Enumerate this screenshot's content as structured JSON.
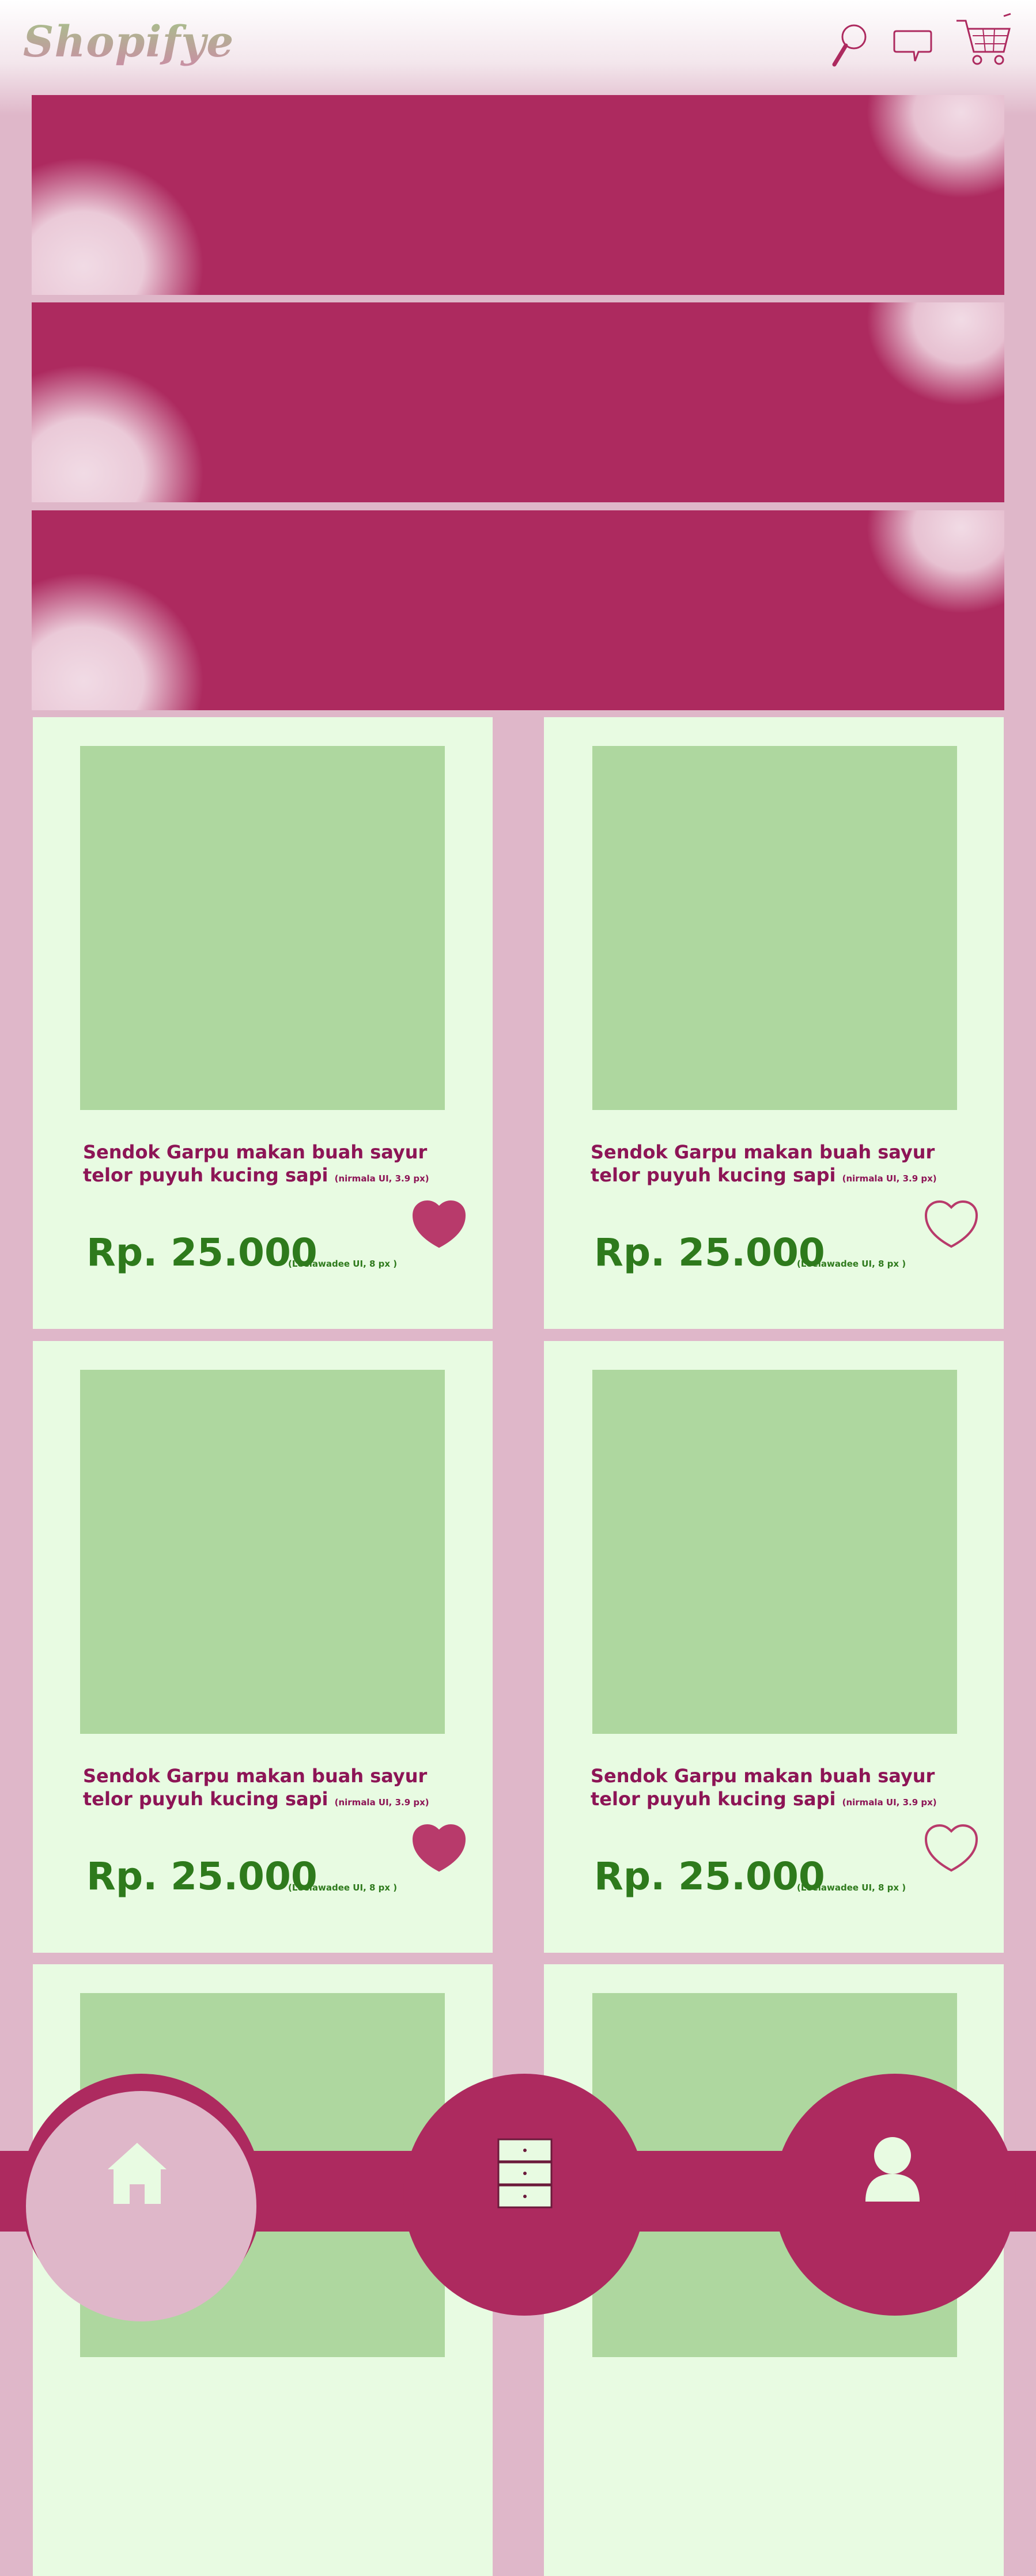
{
  "app": {
    "title": "Shopifye"
  },
  "header": {
    "icons": [
      "search-icon",
      "chat-icon",
      "cart-icon"
    ]
  },
  "colors": {
    "accent": "#ad2a5f",
    "background": "#dfb7c9",
    "card": "#e8fbe2",
    "image_placeholder": "#aed79f",
    "price": "#2e7a1c",
    "title": "#8d1556"
  },
  "banners": [
    {},
    {},
    {}
  ],
  "products": [
    {
      "name": "Sendok Garpu makan buah sayur telor puyuh kucing sapi",
      "name_note": "(nirmala UI, 3.9 px)",
      "price": "Rp. 25.000",
      "price_note": "(Leelawadee UI, 8 px )",
      "favorited": true
    },
    {
      "name": "Sendok Garpu makan buah sayur telor puyuh kucing sapi",
      "name_note": "(nirmala UI, 3.9 px)",
      "price": "Rp. 25.000",
      "price_note": "(Leelawadee UI, 8 px )",
      "favorited": false
    },
    {
      "name": "Sendok Garpu makan buah sayur telor puyuh kucing sapi",
      "name_note": "(nirmala UI, 3.9 px)",
      "price": "Rp. 25.000",
      "price_note": "(Leelawadee UI, 8 px )",
      "favorited": true
    },
    {
      "name": "Sendok Garpu makan buah sayur telor puyuh kucing sapi",
      "name_note": "(nirmala UI, 3.9 px)",
      "price": "Rp. 25.000",
      "price_note": "(Leelawadee UI, 8 px )",
      "favorited": false
    }
  ],
  "bottom_nav": {
    "items": [
      {
        "icon": "home-icon",
        "active": true
      },
      {
        "icon": "drawer-icon",
        "active": false
      },
      {
        "icon": "profile-icon",
        "active": false
      }
    ]
  }
}
